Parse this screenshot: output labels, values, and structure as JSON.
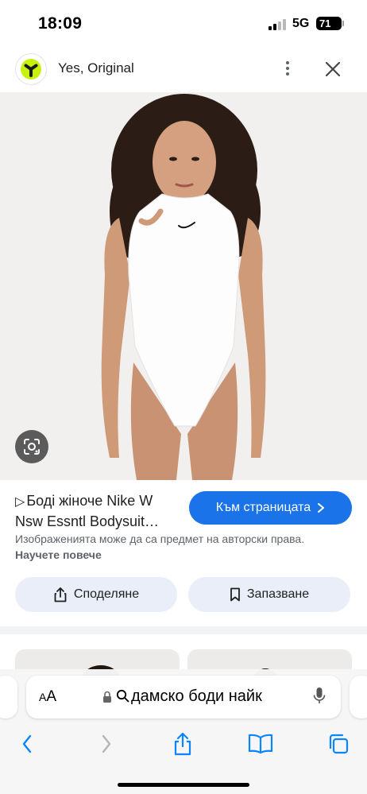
{
  "status_bar": {
    "time": "18:09",
    "network": "5G",
    "battery": "71"
  },
  "header": {
    "site_name": "Yes, Original",
    "logo_color": "#c6f20c"
  },
  "image": {
    "lens_icon": "google-lens-icon"
  },
  "result": {
    "title_line1": "Боді жіноче Nike W",
    "title_line2": "Nsw Essntl Bodysuit…",
    "visit_label": "Към страницата",
    "copyright_text": "Изображенията може да са предмет на авторски права.",
    "learn_more": "Научете повече",
    "share_label": "Споделяне",
    "save_label": "Запазване"
  },
  "browser": {
    "aa_label": "AA",
    "url_text": "дамско боди найк"
  },
  "colors": {
    "accent": "#1a73e8",
    "pill_bg": "#e9eef8"
  }
}
